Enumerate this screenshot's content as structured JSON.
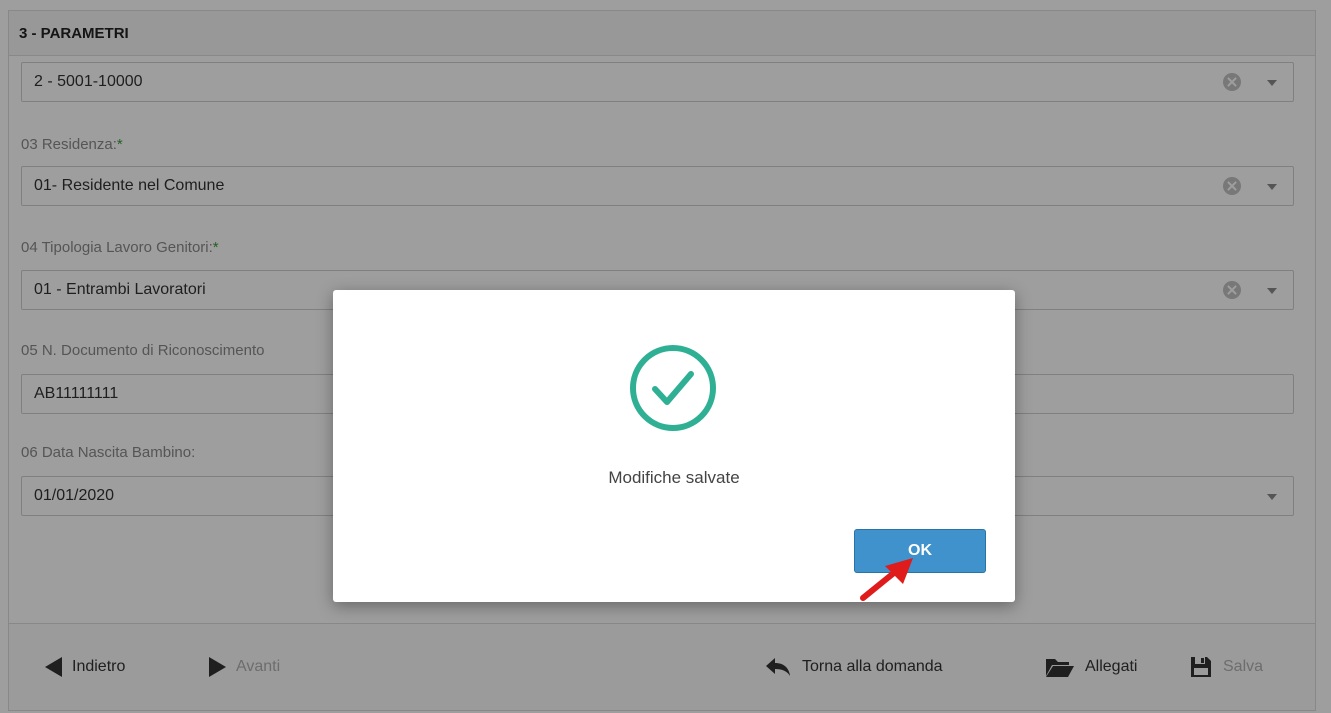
{
  "section": {
    "title": "3 - PARAMETRI"
  },
  "fields": [
    {
      "label": "",
      "required": false,
      "value": "2 - 5001-10000",
      "clearable": true,
      "dropdown": true
    },
    {
      "label": "03 Residenza:",
      "required": true,
      "value": "01- Residente nel Comune",
      "clearable": true,
      "dropdown": true
    },
    {
      "label": "04 Tipologia Lavoro Genitori:",
      "required": true,
      "value": "01 - Entrambi Lavoratori",
      "clearable": true,
      "dropdown": true
    },
    {
      "label": "05 N. Documento di Riconoscimento",
      "required": false,
      "value": "AB11111111",
      "clearable": false,
      "dropdown": false
    },
    {
      "label": "06 Data Nascita Bambino:",
      "required": false,
      "value": "01/01/2020",
      "clearable": false,
      "dropdown": true
    }
  ],
  "required_marker": "*",
  "toolbar": {
    "back": "Indietro",
    "next": "Avanti",
    "return": "Torna alla domanda",
    "attachments": "Allegati",
    "save": "Salva"
  },
  "dialog": {
    "message": "Modifiche salvate",
    "ok_label": "OK",
    "icon": "check-circle-icon",
    "icon_color": "#2fb094"
  },
  "colors": {
    "ok_button": "#3f92cc",
    "arrow": "#e01b1b",
    "required": "#3a9a3a"
  }
}
